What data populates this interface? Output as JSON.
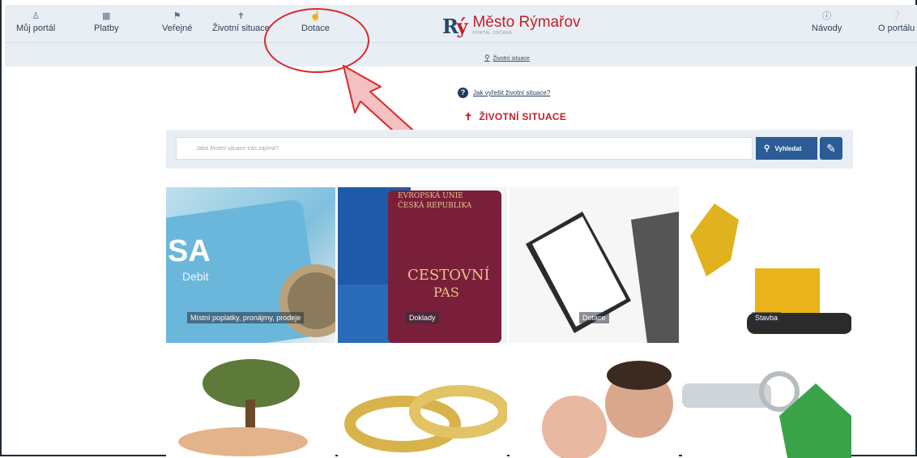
{
  "nav": {
    "items": [
      {
        "label": "Můj portál",
        "icon": "user-icon"
      },
      {
        "label": "Platby",
        "icon": "wallet-icon"
      },
      {
        "label": "Veřejné",
        "icon": "flag-icon"
      },
      {
        "label": "Životní situace",
        "icon": "signpost-icon"
      },
      {
        "label": "Dotace",
        "icon": "thumb-icon"
      }
    ],
    "right_items": [
      {
        "label": "Návody",
        "icon": "info-icon"
      },
      {
        "label": "O portálu",
        "icon": "question-icon"
      }
    ]
  },
  "brand": {
    "title": "Město Rýmařov",
    "subtitle": "PORTÁL OBČANA"
  },
  "breadcrumb": "Životní situace",
  "help_link": "Jak vyřešit životní situace?",
  "section_title": "ŽIVOTNÍ SITUACE",
  "search": {
    "placeholder": "Jaká životní situace Vás zajímá?",
    "button_label": "Vyhledat"
  },
  "tiles": [
    {
      "label": "Místní poplatky, pronájmy, prodeje"
    },
    {
      "label": "Doklady"
    },
    {
      "label": "Dotace"
    },
    {
      "label": "Stavba"
    },
    {
      "label": ""
    },
    {
      "label": ""
    },
    {
      "label": ""
    },
    {
      "label": ""
    }
  ],
  "passport_text": {
    "line1": "EVROPSKÁ UNIE",
    "line2": "ČESKÁ REPUBLIKA",
    "line3": "CESTOVNÍ",
    "line4": "PAS"
  },
  "card_text": {
    "brand": "SA",
    "sub": "Debit"
  },
  "colors": {
    "brand_red": "#c0202a",
    "brand_blue": "#2b5c95",
    "annotation": "#d62b2b"
  }
}
